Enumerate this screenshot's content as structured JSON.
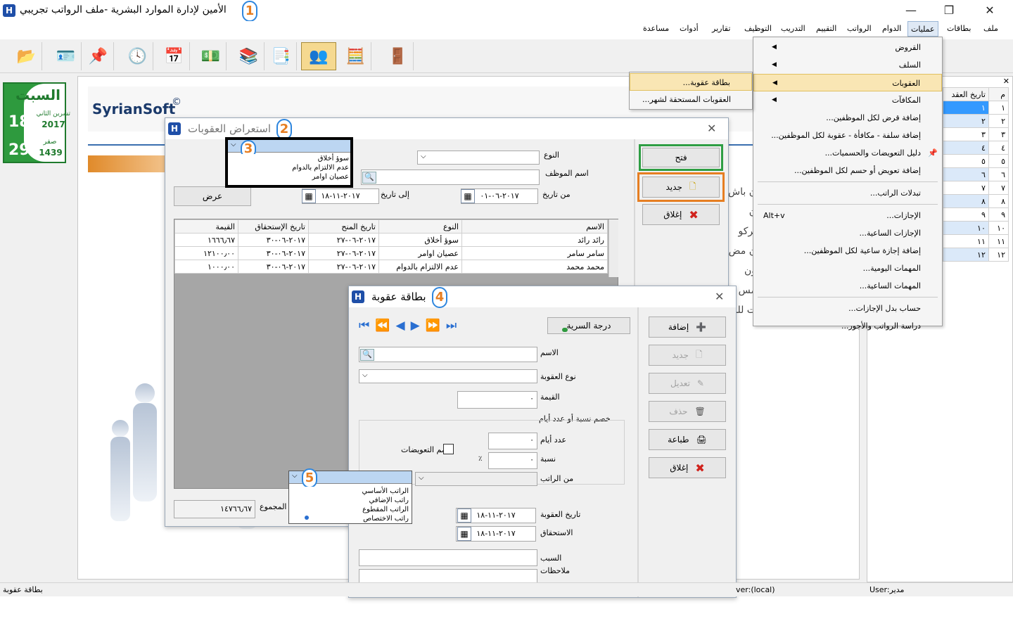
{
  "title_bar": {
    "title": "الأمين لإدارة الموارد البشرية -ملف الرواتب تجريبي",
    "logo": "H",
    "badge1": "1",
    "min": "—",
    "restore": "❐",
    "close": "✕"
  },
  "menubar": {
    "items": [
      "ملف",
      "بطاقات",
      "عمليات",
      "الدوام",
      "الرواتب",
      "التقييم",
      "التدريب",
      "التوظيف",
      "تقارير",
      "أدوات",
      "مساعدة"
    ]
  },
  "operations_menu": {
    "items": [
      {
        "label": "القروض",
        "submenu": true
      },
      {
        "label": "السلف",
        "submenu": true
      },
      {
        "label": "العقوبات",
        "submenu": true
      },
      {
        "label": "المكافآت",
        "submenu": true
      },
      {
        "label": "إضافة قرض لكل الموظفين..."
      },
      {
        "label": "إضافة سلفة - مكافأة - عقوبة لكل الموظفين..."
      },
      {
        "label": "دليل التعويضات والحسميات..."
      },
      {
        "label": "إضافة تعويض أو حسم لكل الموظفين..."
      },
      {
        "label": "تبدلات الراتب..."
      },
      {
        "label": "الإجازات...",
        "shortcut": "Alt+v"
      },
      {
        "label": "الإجازات الساعية..."
      },
      {
        "label": "إضافة إجازة ساعية لكل الموظفين..."
      },
      {
        "label": "المهمات اليومية..."
      },
      {
        "label": "المهمات الساعية..."
      },
      {
        "label": "حساب بدل الإجازات..."
      },
      {
        "label": "دراسة الرواتب والأجور..."
      }
    ]
  },
  "penalties_submenu": {
    "items": [
      "بطاقة عقوبة...",
      "العقوبات المستحقة لشهر..."
    ]
  },
  "date_widget": {
    "day": "السبت",
    "greg_day": "18",
    "greg_month": "تشرين الثاني",
    "greg_year": "2017",
    "hijri_day": "29",
    "hijri_month": "صفر",
    "hijri_year": "1439"
  },
  "brand": {
    "name": "SyrianSoft",
    "mark": "©"
  },
  "bg_text": [
    "ن باش",
    "ن تركو",
    "ن مض",
    "ون مس",
    "ت للم"
  ],
  "right_grid": {
    "headers": [
      "م",
      "تاريخ العقد"
    ],
    "rows": [
      "١",
      "٢",
      "٣",
      "٤",
      "٥",
      "٦",
      "٧",
      "٨",
      "٩",
      "١٠",
      "١١",
      "١٢"
    ],
    "col2": [
      "١",
      "٢",
      "٣",
      "٤",
      "٥",
      "٦",
      "٧",
      "٨",
      "٩",
      "١٠",
      "١١",
      "١٢"
    ]
  },
  "review_window": {
    "title": "استعراض العقوبات",
    "badge": "2",
    "type_label": "النوع",
    "employee_label": "اسم الموظف",
    "from_label": "من تاريخ",
    "from_value": "٢٠١٧-٠٦-٠١",
    "to_label": "إلى تاريخ",
    "to_value": "٢٠١٧-١١-١٨",
    "show_button": "عرض",
    "open_button": "فتح",
    "new_button": "جديد",
    "close_button": "إغلاق",
    "total_label": "المجموع",
    "total_value": "١٤٧٦٦٫٦٧",
    "columns": [
      "الاسم",
      "النوع",
      "تاريخ المنح",
      "تاريخ الإستحقاق",
      "القيمة"
    ],
    "rows": [
      [
        "رائد رائد",
        "سوؤ أخلاق",
        "٢٠١٧-٠٦-٢٧",
        "٢٠١٧-٠٦-٣٠",
        "١٦٦٦٫٦٧"
      ],
      [
        "سامر سامر",
        "عصيان اوامر",
        "٢٠١٧-٠٦-٢٧",
        "٢٠١٧-٠٦-٣٠",
        "١٢١٠٠٫٠٠"
      ],
      [
        "محمد محمد",
        "عدم الالتزام بالدوام",
        "٢٠١٧-٠٦-٢٧",
        "٢٠١٧-٠٦-٣٠",
        "١٠٠٠٫٠٠"
      ]
    ]
  },
  "type_dropdown": {
    "badge": "3",
    "options": [
      "سوؤ أخلاق",
      "عدم الالتزام بالدوام",
      "عصيان اوامر"
    ]
  },
  "card_window": {
    "title": "بطاقة عقوبة",
    "badge": "4",
    "secrecy_button": "درجة السرية",
    "name_label": "الاسم",
    "penalty_type_label": "نوع العقوبة",
    "value_label": "القيمة",
    "value": "٠",
    "deduct_group_label": "خصم نسبة أو عدد أيام",
    "days_label": "عدد أيام",
    "days_value": "٠",
    "percent_label": "نسبة",
    "percent_value": "٠",
    "percent_sign": "٪",
    "include_comp_label": "ضم التعويضات",
    "from_salary_label": "من الراتب",
    "penalty_date_label": "تاريخ العقوبة",
    "penalty_date": "٢٠١٧-١١-١٨",
    "due_label": "الاستحقاق",
    "due_date": "٢٠١٧-١١-١٨",
    "reason_label": "السبب",
    "notes_label": "ملاحظات",
    "buttons": {
      "add": "إضافة",
      "new": "جديد",
      "edit": "تعديل",
      "delete": "حذف",
      "print": "طباعة",
      "close": "إغلاق"
    }
  },
  "salary_dropdown": {
    "badge": "5",
    "options": [
      "الراتب الأساسي",
      "راتب الإضافي",
      "الراتب المقطوع",
      "راتب الاختصاص"
    ]
  },
  "status_bar": {
    "left": "بطاقة عقوبة",
    "server": "ver:(local)",
    "user": "User:مدير"
  },
  "colors": {
    "accent_green": "#2e9a3e",
    "highlight_gold": "#f9e6b4",
    "selection_blue": "#3399ff",
    "badge_orange": "#e67e22",
    "badge_border": "#2e86de"
  }
}
